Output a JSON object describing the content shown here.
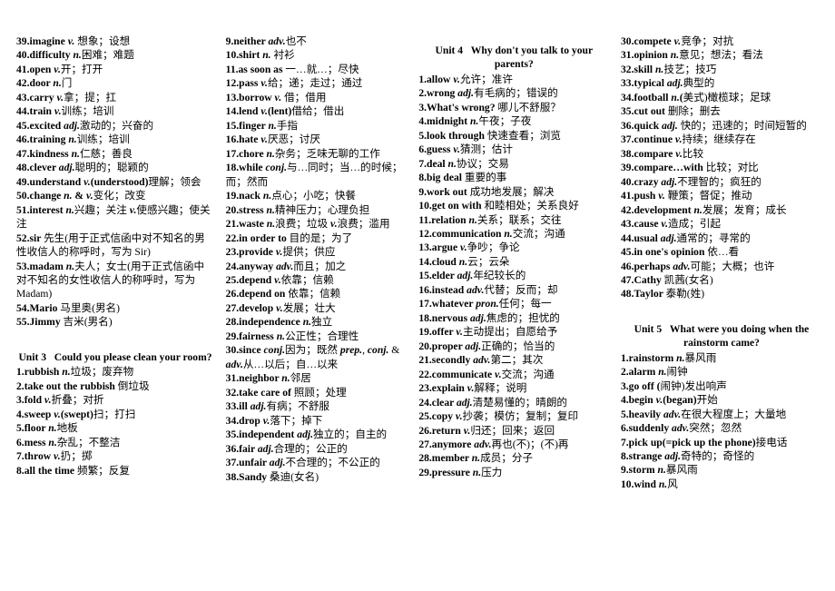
{
  "document": {
    "title": "Units 3-5 English Vocabulary List",
    "columns": [
      {
        "id": "column-1",
        "blocks": [
          {
            "type": "entries",
            "items": [
              "39.imagine v. 想象；设想",
              "40.difficulty n.困难；难题",
              "41.open v.开；打开",
              "42.door n.门",
              "43.carry v.拿；提；扛",
              "44.train v.训练；培训",
              "45.excited adj.激动的；兴奋的",
              "46.training n.训练；培训",
              "47.kindness n.仁慈；善良",
              "48.clever adj.聪明的；聪颖的",
              "49.understand v.(understood)理解；领会",
              "50.change n. & v.变化；改变",
              "51.interest n.兴趣；关注 v.使感兴趣；使关注",
              "52.sir 先生(用于正式信函中对不知名的男性收信人的称呼时，写为 Sir)",
              "53.madam n.夫人；女士(用于正式信函中对不知名的女性收信人的称呼时，写为 Madam)",
              "54.Mario 马里奥(男名)",
              "55.Jimmy 吉米(男名)"
            ]
          },
          {
            "type": "unit-heading",
            "unit": "Unit 3",
            "title": "Could you please clean your room?"
          },
          {
            "type": "entries",
            "items": [
              "1.rubbish n.垃圾；废弃物",
              "2.take out the rubbish 倒垃圾",
              "3.fold v.折叠；对折",
              "4.sweep v.(swept)扫；打扫",
              "5.floor n.地板",
              "6.mess n.杂乱；不整洁",
              "7.throw v.扔；掷",
              "8.all the time 频繁；反复"
            ]
          }
        ]
      },
      {
        "id": "column-2",
        "blocks": [
          {
            "type": "entries",
            "items": [
              "9.neither adv.也不",
              "10.shirt n. 衬衫",
              "11.as soon as 一…就…；尽快",
              "12.pass v.给；递；走过；通过",
              "13.borrow v. 借；借用",
              "14.lend v.(lent)借给；借出",
              "15.finger n.手指",
              "16.hate v.厌恶；讨厌",
              "17.chore n.杂务；乏味无聊的工作",
              "18.while conj.与…同时；当…的时候；而；然而",
              "19.nack n.点心；小吃；快餐",
              "20.stress n.精神压力；心理负担",
              "21.waste n.浪费；垃圾 v.浪费；滥用",
              "22.in order to 目的是；为了",
              "23.provide v.提供；供应",
              "24.anyway adv.而且；加之",
              "25.depend v.依靠；信赖",
              "26.depend on 依靠；信赖",
              "27.develop v.发展；壮大",
              "28.independence n.独立",
              "29.fairness n.公正性；合理性",
              "30.since conj.因为；既然 prep., conj. & adv.从…以后；自…以来",
              "31.neighbor n.邻居",
              "32.take care of 照顾；处理",
              "33.ill adj.有病；不舒服",
              "34.drop v.落下；掉下",
              "35.independent adj.独立的；自主的",
              "36.fair adj.合理的；公正的",
              "37.unfair adj.不合理的；不公正的",
              "38.Sandy 桑迪(女名)"
            ]
          }
        ]
      },
      {
        "id": "column-3",
        "blocks": [
          {
            "type": "unit-heading",
            "unit": "Unit 4",
            "title": "Why don't you talk to your parents?"
          },
          {
            "type": "entries",
            "items": [
              "1.allow v.允许；准许",
              "2.wrong adj.有毛病的；错误的",
              "3.What's wrong? 哪儿不舒服？",
              "4.midnight n.午夜；子夜",
              "5.look through 快速查看；浏览",
              "6.guess v.猜测；估计",
              "7.deal n.协议；交易",
              "8.big deal 重要的事",
              "9.work out 成功地发展；解决",
              "10.get on with 和睦相处；关系良好",
              "11.relation n.关系；联系；交往",
              "12.communication n.交流；沟通",
              "13.argue v.争吵；争论",
              "14.cloud n.云；云朵",
              "15.elder adj.年纪较长的",
              "16.instead adv.代替；反而；却",
              "17.whatever pron.任何；每一",
              "18.nervous adj.焦虑的；担忧的",
              "19.offer v.主动提出；自愿给予",
              "20.proper adj.正确的；恰当的",
              "21.secondly adv.第二；其次",
              "22.communicate v.交流；沟通",
              "23.explain v.解释；说明",
              "24.clear adj.清楚易懂的；晴朗的",
              "25.copy v.抄袭；模仿；复制；复印",
              "26.return v.归还；回来；返回",
              "27.anymore adv.再也(不)；(不)再",
              "28.member n.成员；分子",
              "29.pressure n.压力"
            ]
          }
        ]
      },
      {
        "id": "column-4",
        "blocks": [
          {
            "type": "entries",
            "items": [
              "30.compete v.竞争；对抗",
              "31.opinion n.意见；想法；看法",
              "32.skill n.技艺；技巧",
              "33.typical adj.典型的",
              "34.football n.(美式)橄榄球；足球",
              "35.cut out 删除；删去",
              "36.quick adj. 快的；迅速的；时间短暂的",
              "37.continue v.持续；继续存在",
              "38.compare v.比较",
              "39.compare…with 比较；对比",
              "40.crazy adj.不理智的；疯狂的",
              "41.push v. 鞭策；督促；推动",
              "42.development n.发展；发育；成长",
              "43.cause v.造成；引起",
              "44.usual adj.通常的；寻常的",
              "45.in one's opinion 依…看",
              "46.perhaps adv.可能；大概；也许",
              "47.Cathy 凯茜(女名)",
              "48.Taylor 泰勒(姓)"
            ]
          },
          {
            "type": "unit-heading",
            "unit": "Unit 5",
            "title": "What were you doing when the rainstorm came?"
          },
          {
            "type": "entries",
            "items": [
              "1.rainstorm n.暴风雨",
              "2.alarm n.闹钟",
              "3.go off (闹钟)发出响声",
              "4.begin v.(began)开始",
              "5.heavily adv.在很大程度上；大量地",
              "6.suddenly adv.突然；忽然",
              "7.pick up(=pick up the phone)接电话",
              "8.strange adj.奇特的；奇怪的",
              "9.storm n.暴风雨",
              "10.wind n.风"
            ]
          }
        ]
      }
    ]
  }
}
